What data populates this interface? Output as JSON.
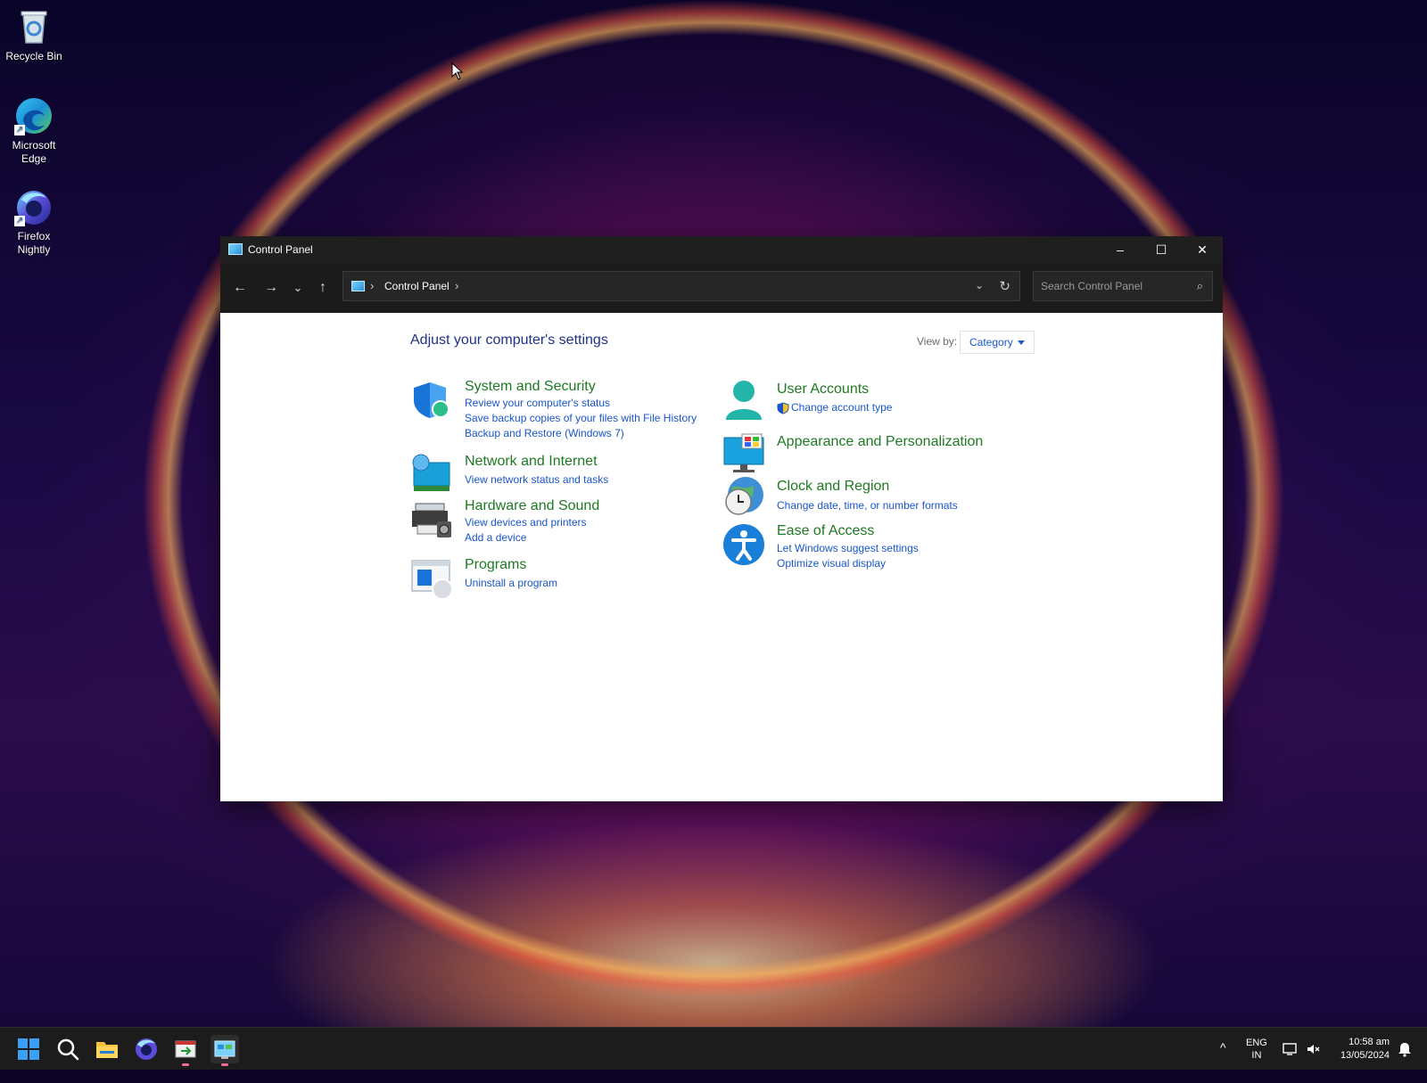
{
  "desktop": {
    "icons": [
      {
        "label": "Recycle Bin"
      },
      {
        "label": "Microsoft Edge"
      },
      {
        "label": "Firefox Nightly"
      }
    ]
  },
  "window": {
    "title": "Control Panel",
    "minimize": "–",
    "maximize": "☐",
    "close": "✕",
    "nav": {
      "back": "←",
      "forward": "→",
      "recent": "⌄",
      "up": "↑"
    },
    "address": {
      "separator": "›",
      "crumb": "Control Panel",
      "trailing_sep": "›",
      "dropdown": "⌄",
      "refresh": "↻"
    },
    "search": {
      "placeholder": "Search Control Panel",
      "icon": "⌕"
    }
  },
  "content": {
    "heading": "Adjust your computer's settings",
    "view_by_label": "View by:",
    "view_by_value": "Category",
    "left": [
      {
        "title": "System and Security",
        "links": [
          "Review your computer's status",
          "Save backup copies of your files with File History",
          "Backup and Restore (Windows 7)"
        ]
      },
      {
        "title": "Network and Internet",
        "links": [
          "View network status and tasks"
        ]
      },
      {
        "title": "Hardware and Sound",
        "links": [
          "View devices and printers",
          "Add a device"
        ]
      },
      {
        "title": "Programs",
        "links": [
          "Uninstall a program"
        ]
      }
    ],
    "right": [
      {
        "title": "User Accounts",
        "links": [
          "Change account type"
        ]
      },
      {
        "title": "Appearance and Personalization",
        "links": []
      },
      {
        "title": "Clock and Region",
        "links": [
          "Change date, time, or number formats"
        ]
      },
      {
        "title": "Ease of Access",
        "links": [
          "Let Windows suggest settings",
          "Optimize visual display"
        ]
      }
    ]
  },
  "taskbar": {
    "tray": {
      "chevron": "^",
      "lang_top": "ENG",
      "lang_bottom": "IN",
      "time": "10:58 am",
      "date": "13/05/2024"
    }
  },
  "colors": {
    "category_title": "#1e7a21",
    "link": "#1a56c9",
    "heading": "#1e3287",
    "titlebar": "#1f1f1f"
  }
}
